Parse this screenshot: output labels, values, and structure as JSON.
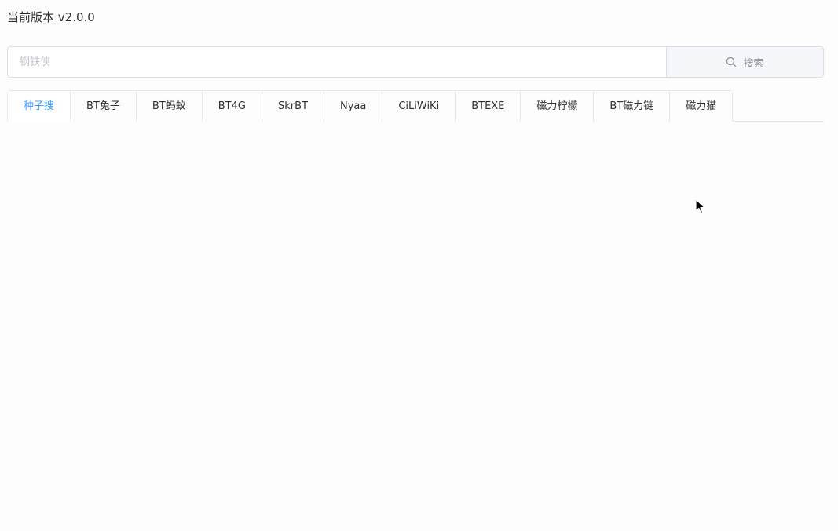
{
  "header": {
    "version_text": "当前版本 v2.0.0"
  },
  "search": {
    "placeholder": "钢铁侠",
    "value": "",
    "button_label": "搜索",
    "button_icon": "search-icon"
  },
  "tabs": [
    {
      "label": "种子搜",
      "active": true
    },
    {
      "label": "BT兔子",
      "active": false
    },
    {
      "label": "BT蚂蚁",
      "active": false
    },
    {
      "label": "BT4G",
      "active": false
    },
    {
      "label": "SkrBT",
      "active": false
    },
    {
      "label": "Nyaa",
      "active": false
    },
    {
      "label": "CiLiWiKi",
      "active": false
    },
    {
      "label": "BTEXE",
      "active": false
    },
    {
      "label": "磁力柠檬",
      "active": false
    },
    {
      "label": "BT磁力链",
      "active": false
    },
    {
      "label": "磁力猫",
      "active": false
    }
  ],
  "colors": {
    "accent": "#409eff",
    "border": "#e4e7ed",
    "text": "#303133",
    "muted": "#909399"
  }
}
